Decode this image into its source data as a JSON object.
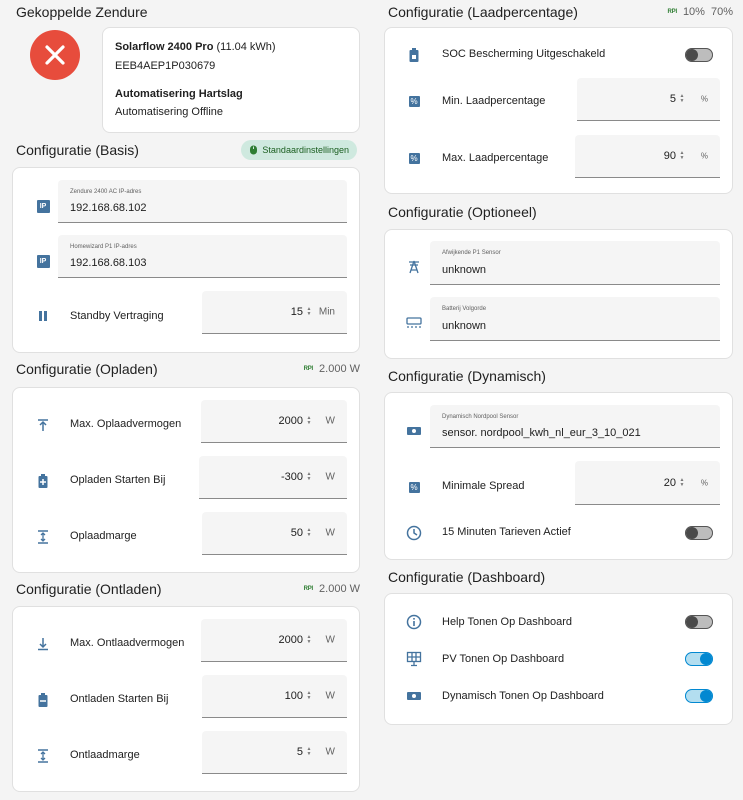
{
  "colors": {
    "accent": "#44739e",
    "error": "#e74c3c",
    "toggle_on": "#0288d1",
    "chip_bg": "#cfe9df"
  },
  "coupled": {
    "title": "Gekoppelde Zendure",
    "device_name": "Solarflow 2400 Pro",
    "device_capacity": "(11.04 kWh)",
    "serial": "EEB4AEP1P030679",
    "automation_title": "Automatisering Hartslag",
    "automation_status": "Automatisering Offline",
    "status_icon": "close-icon"
  },
  "basis": {
    "title": "Configuratie (Basis)",
    "chip_label": "Standaardinstellingen",
    "zendure_ip_label": "Zendure 2400 AC IP-adres",
    "zendure_ip_value": "192.168.68.102",
    "homewizard_ip_label": "Homewizard P1 IP-adres",
    "homewizard_ip_value": "192.168.68.103",
    "standby_label": "Standby Vertraging",
    "standby_value": "15",
    "standby_unit": "Min"
  },
  "opladen": {
    "title": "Configuratie (Opladen)",
    "badge": "RPI",
    "power": "2.000 W",
    "max_label": "Max. Oplaadvermogen",
    "max_value": "2000",
    "max_unit": "W",
    "start_label": "Opladen Starten Bij",
    "start_value": "-300",
    "start_unit": "W",
    "margin_label": "Oplaadmarge",
    "margin_value": "50",
    "margin_unit": "W"
  },
  "ontladen": {
    "title": "Configuratie (Ontladen)",
    "badge": "RPI",
    "power": "2.000 W",
    "max_label": "Max. Ontlaadvermogen",
    "max_value": "2000",
    "max_unit": "W",
    "start_label": "Ontladen Starten Bij",
    "start_value": "100",
    "start_unit": "W",
    "margin_label": "Ontlaadmarge",
    "margin_value": "5",
    "margin_unit": "W"
  },
  "laad": {
    "title": "Configuratie (Laadpercentage)",
    "badge": "RPI",
    "min_pct": "10%",
    "max_pct": "70%",
    "soc_label": "SOC Bescherming Uitgeschakeld",
    "soc_on": false,
    "min_label": "Min. Laadpercentage",
    "min_value": "5",
    "min_unit": "%",
    "max_label": "Max. Laadpercentage",
    "max_value": "90",
    "max_unit": "%"
  },
  "optioneel": {
    "title": "Configuratie (Optioneel)",
    "p1_label": "Afwijkende P1 Sensor",
    "p1_value": "unknown",
    "battery_label": "Batterij Volgorde",
    "battery_value": "unknown"
  },
  "dynamisch": {
    "title": "Configuratie (Dynamisch)",
    "sensor_label": "Dynamisch Nordpool Sensor",
    "sensor_value": "sensor. nordpool_kwh_nl_eur_3_10_021",
    "spread_label": "Minimale Spread",
    "spread_value": "20",
    "spread_unit": "%",
    "tarief_label": "15 Minuten Tarieven Actief",
    "tarief_on": false
  },
  "dashboard": {
    "title": "Configuratie (Dashboard)",
    "help_label": "Help Tonen Op Dashboard",
    "help_on": false,
    "pv_label": "PV Tonen Op Dashboard",
    "pv_on": true,
    "dyn_label": "Dynamisch Tonen Op Dashboard",
    "dyn_on": true
  }
}
